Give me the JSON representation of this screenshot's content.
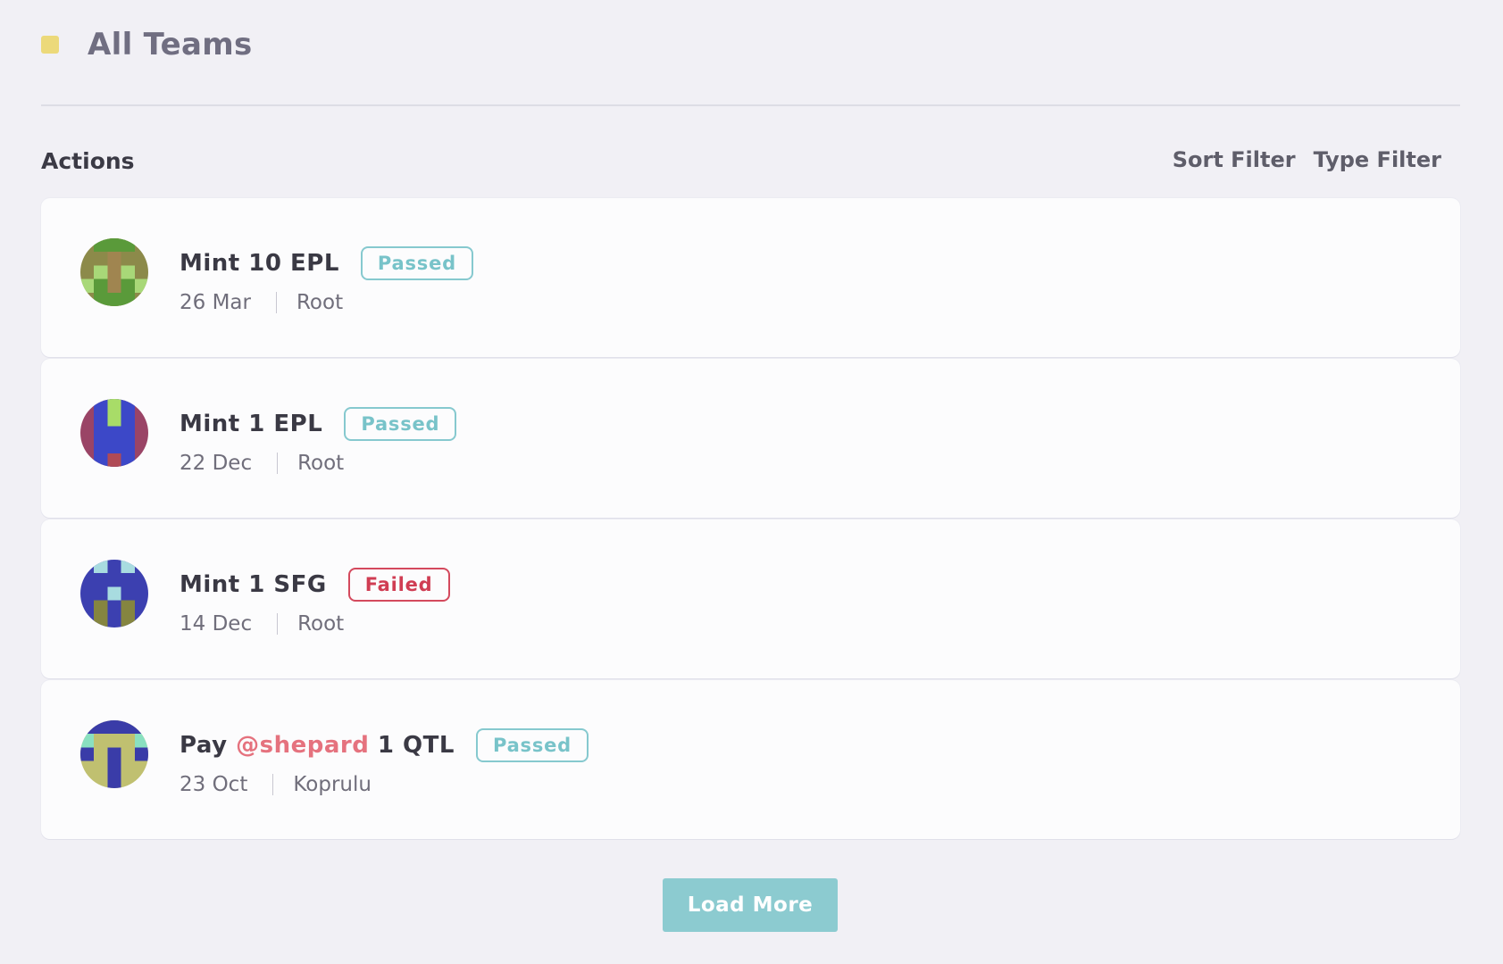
{
  "header": {
    "title": "All Teams",
    "swatch_color": "#ecd97a"
  },
  "actions": {
    "title": "Actions",
    "filters": {
      "sort": "Sort Filter",
      "type": "Type Filter"
    },
    "items": [
      {
        "title_prefix": "Mint 10 EPL",
        "mention": "",
        "title_suffix": "",
        "status": "Passed",
        "date": "26 Mar",
        "domain": "Root"
      },
      {
        "title_prefix": "Mint 1 EPL",
        "mention": "",
        "title_suffix": "",
        "status": "Passed",
        "date": "22 Dec",
        "domain": "Root"
      },
      {
        "title_prefix": "Mint 1 SFG",
        "mention": "",
        "title_suffix": "",
        "status": "Failed",
        "date": "14 Dec",
        "domain": "Root"
      },
      {
        "title_prefix": "Pay ",
        "mention": "@shepard",
        "title_suffix": " 1 QTL",
        "status": "Passed",
        "date": "23 Oct",
        "domain": "Koprulu"
      }
    ]
  },
  "load_more": "Load More",
  "colors": {
    "passed": "#78c3c9",
    "failed": "#d03d53",
    "mention": "#e5727e",
    "button": "#8ccbd0"
  }
}
